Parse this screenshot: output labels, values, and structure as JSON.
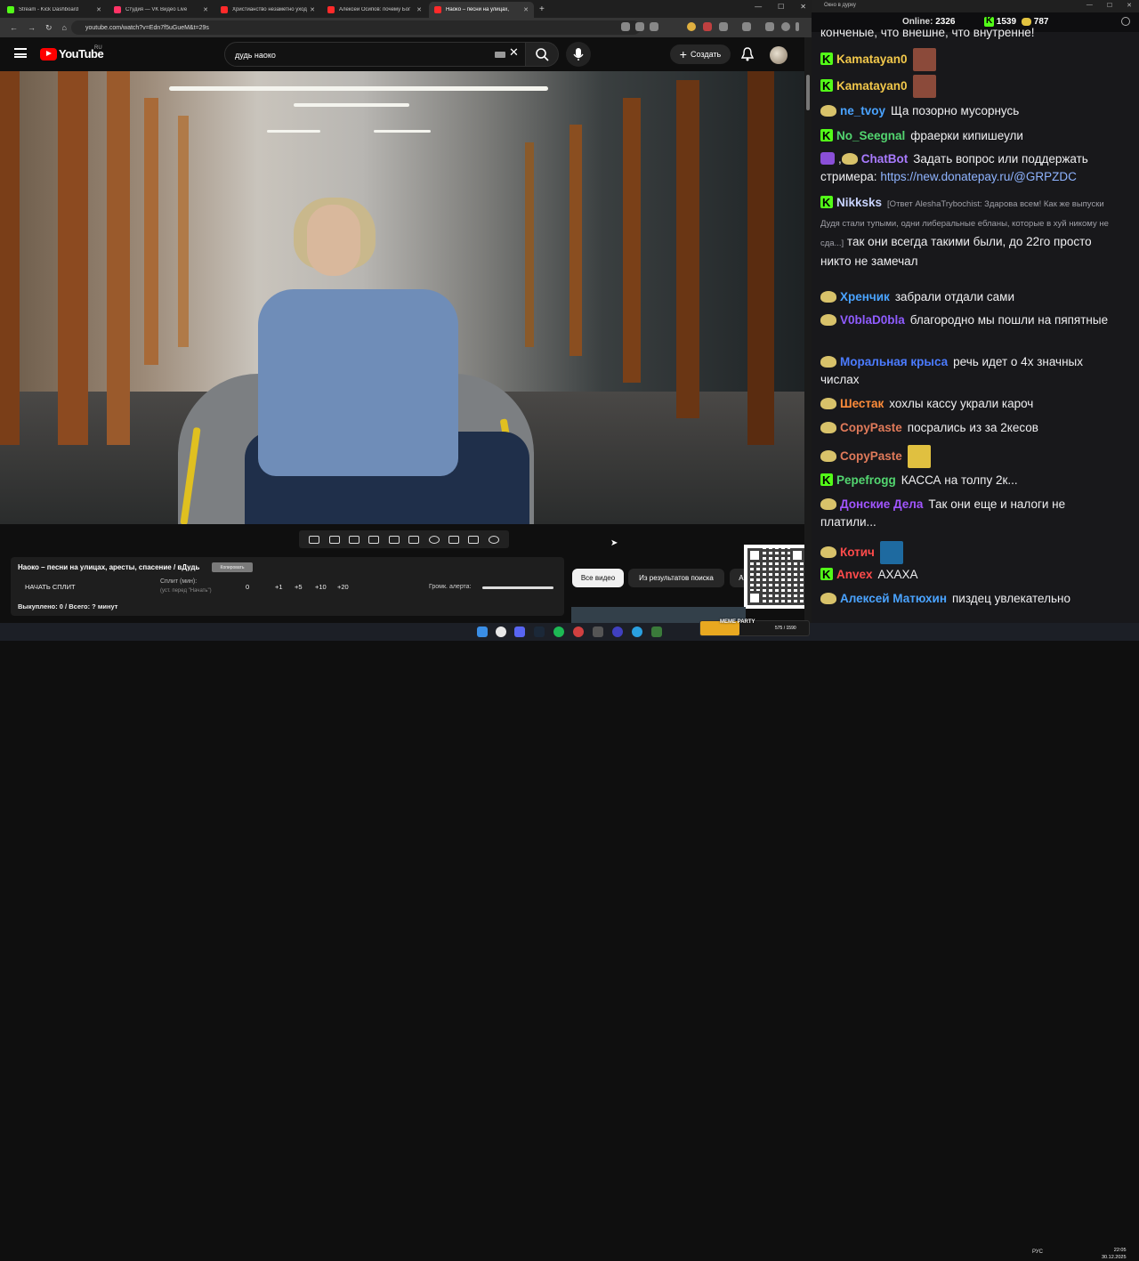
{
  "browser": {
    "tabs": [
      {
        "title": "Stream - Kick Dashboard",
        "color": "#53fc18",
        "active": false
      },
      {
        "title": "Студия — VK Видео Live",
        "color": "#ff3366",
        "active": false
      },
      {
        "title": "Христианство незаметно уход",
        "color": "#ff2a2a",
        "active": false
      },
      {
        "title": "Алексей Осипов: почему Бог",
        "color": "#ff2a2a",
        "active": false
      },
      {
        "title": "Наоко – песни на улицах,",
        "color": "#ff2a2a",
        "active": true
      }
    ],
    "url": "youtube.com/watch?v=Edn7f5uGueM&t=29s"
  },
  "youtube": {
    "logo_text": "YouTube",
    "region": "RU",
    "search_value": "дудь наоко",
    "create_label": "Создать"
  },
  "streamer_panel": {
    "video_title": "Наоко – песни на улицах, аресты, спасение / вДудь",
    "copy_label": "Копировать",
    "start_split_label": "НАЧАТЬ СПЛИТ",
    "split_label": "Сплит (мин):",
    "split_hint": "(уст. перед \"Начать\")",
    "split_value": "0",
    "increments": [
      "+1",
      "+5",
      "+10",
      "+20"
    ],
    "alert_volume_label": "Громк. алерта:",
    "alert_volume_fraction": 1.0,
    "bought_label": "Выкуплено: 0 / Всего: ? минут"
  },
  "chips": [
    "Все видео",
    "Из результатов поиска",
    "Ав"
  ],
  "chat": {
    "window_title": "Окно в дурку",
    "online_label": "Online:",
    "online_count": "2326",
    "kick_count": "1539",
    "gold_count": "787",
    "partial_top": "конченые, что внешне, что внутренне!",
    "messages": [
      {
        "name": "Kamatayan0",
        "color": "#f2c84b",
        "badge": "kick",
        "text": "",
        "emote": "#8b4a3a"
      },
      {
        "name": "Kamatayan0",
        "color": "#f2c84b",
        "badge": "kick",
        "text": "",
        "emote": "#8b4a3a"
      },
      {
        "name": "ne_tvoy",
        "color": "#4aa3ff",
        "badge": "pepe",
        "text": "Ща позорно мусорнусь"
      },
      {
        "name": "No_Seegnal",
        "color": "#53d670",
        "badge": "kick",
        "text": "фраерки кипишеули"
      },
      {
        "name": "ChatBot",
        "color": "#a97bff",
        "badge": "bot",
        "text": "Задать вопрос или поддержать стримера:",
        "link": "https://new.donatepay.ru/@GRPZDC"
      },
      {
        "name": "Nikksks",
        "color": "#c9d4ff",
        "badge": "kick",
        "reply": "[Ответ AleshaTrybochist: Здарова всем! Как же выпуски Дудя стали тупыми, одни либеральные ебланы, которые в хуй никому не сда...]",
        "text": "так они всегда такими были, до 22го просто никто не замечал"
      },
      {
        "name": "Хренчик",
        "color": "#4aa3ff",
        "badge": "pepe",
        "text": "забрали отдали сами"
      },
      {
        "name": "V0blaD0bla",
        "color": "#8f5cff",
        "badge": "pepe",
        "text": "благородно мы пошли на пяпятные"
      },
      {
        "name": "Моральная крыса",
        "color": "#4b7bff",
        "badge": "pepe",
        "text": "речь идет о 4х значных числах"
      },
      {
        "name": "Шестак",
        "color": "#ff8c3a",
        "badge": "pepe",
        "text": "хохлы кассу украли кароч"
      },
      {
        "name": "CopyPaste",
        "color": "#e07a5a",
        "badge": "pepe",
        "text": "посрались из за 2кесов"
      },
      {
        "name": "CopyPaste",
        "color": "#e07a5a",
        "badge": "pepe",
        "text": "",
        "emote": "#e0c040"
      },
      {
        "name": "Pepefrogg",
        "color": "#53d670",
        "badge": "kick",
        "text": "КАССА на толпу 2к..."
      },
      {
        "name": "Донские Дела",
        "color": "#a155ff",
        "badge": "pepe",
        "text": "Так они еще и налоги не платили..."
      },
      {
        "name": "Котич",
        "color": "#ff4b4b",
        "badge": "pepe",
        "text": "",
        "emote": "#1e6aa0"
      },
      {
        "name": "Anvex",
        "color": "#ff4b4b",
        "badge": "kick",
        "text": "АХАХА"
      },
      {
        "name": "Алексей Матюхин",
        "color": "#4aa3ff",
        "badge": "pepe",
        "text": "пиздец увлекательно"
      }
    ]
  },
  "taskbar": {
    "meme_label": "MEME PARTY",
    "meme_progress": "575 / 1590",
    "meme_fraction": 0.36,
    "lang": "РУС",
    "time": "22:05",
    "date": "30.12.2025"
  }
}
